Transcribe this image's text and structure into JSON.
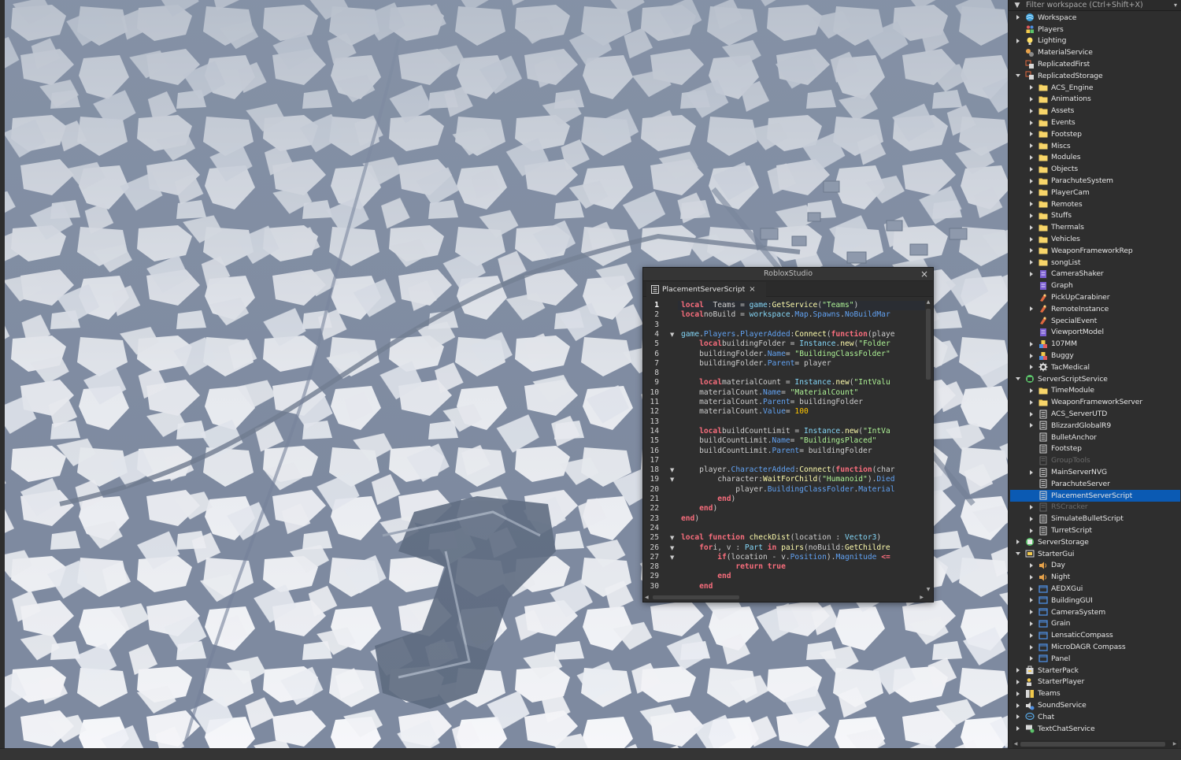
{
  "explorer": {
    "filter_placeholder": "Filter workspace (Ctrl+Shift+X)",
    "items": [
      {
        "label": "Workspace",
        "depth": 0,
        "arrow": "right",
        "icon": "workspace"
      },
      {
        "label": "Players",
        "depth": 0,
        "arrow": "none",
        "icon": "players"
      },
      {
        "label": "Lighting",
        "depth": 0,
        "arrow": "right",
        "icon": "lighting"
      },
      {
        "label": "MaterialService",
        "depth": 0,
        "arrow": "none",
        "icon": "material"
      },
      {
        "label": "ReplicatedFirst",
        "depth": 0,
        "arrow": "none",
        "icon": "replicated"
      },
      {
        "label": "ReplicatedStorage",
        "depth": 0,
        "arrow": "down",
        "icon": "replicated"
      },
      {
        "label": "ACS_Engine",
        "depth": 1,
        "arrow": "right",
        "icon": "folder"
      },
      {
        "label": "Animations",
        "depth": 1,
        "arrow": "right",
        "icon": "folder"
      },
      {
        "label": "Assets",
        "depth": 1,
        "arrow": "right",
        "icon": "folder"
      },
      {
        "label": "Events",
        "depth": 1,
        "arrow": "right",
        "icon": "folder"
      },
      {
        "label": "Footstep",
        "depth": 1,
        "arrow": "right",
        "icon": "folder"
      },
      {
        "label": "Miscs",
        "depth": 1,
        "arrow": "right",
        "icon": "folder"
      },
      {
        "label": "Modules",
        "depth": 1,
        "arrow": "right",
        "icon": "folder"
      },
      {
        "label": "Objects",
        "depth": 1,
        "arrow": "right",
        "icon": "folder"
      },
      {
        "label": "ParachuteSystem",
        "depth": 1,
        "arrow": "right",
        "icon": "folder"
      },
      {
        "label": "PlayerCam",
        "depth": 1,
        "arrow": "right",
        "icon": "folder"
      },
      {
        "label": "Remotes",
        "depth": 1,
        "arrow": "right",
        "icon": "folder"
      },
      {
        "label": "Stuffs",
        "depth": 1,
        "arrow": "right",
        "icon": "folder"
      },
      {
        "label": "Thermals",
        "depth": 1,
        "arrow": "right",
        "icon": "folder"
      },
      {
        "label": "Vehicles",
        "depth": 1,
        "arrow": "right",
        "icon": "folder"
      },
      {
        "label": "WeaponFrameworkRep",
        "depth": 1,
        "arrow": "right",
        "icon": "folder"
      },
      {
        "label": "songList",
        "depth": 1,
        "arrow": "right",
        "icon": "folder"
      },
      {
        "label": "CameraShaker",
        "depth": 1,
        "arrow": "right",
        "icon": "module"
      },
      {
        "label": "Graph",
        "depth": 1,
        "arrow": "none",
        "icon": "module"
      },
      {
        "label": "PickUpCarabiner",
        "depth": 1,
        "arrow": "none",
        "icon": "remote"
      },
      {
        "label": "RemoteInstance",
        "depth": 1,
        "arrow": "right",
        "icon": "remote"
      },
      {
        "label": "SpecialEvent",
        "depth": 1,
        "arrow": "none",
        "icon": "remote"
      },
      {
        "label": "ViewportModel",
        "depth": 1,
        "arrow": "none",
        "icon": "module"
      },
      {
        "label": "107MM",
        "depth": 1,
        "arrow": "right",
        "icon": "model"
      },
      {
        "label": "Buggy",
        "depth": 1,
        "arrow": "right",
        "icon": "model"
      },
      {
        "label": "TacMedical",
        "depth": 1,
        "arrow": "right",
        "icon": "gear"
      },
      {
        "label": "ServerScriptService",
        "depth": 0,
        "arrow": "down",
        "icon": "serverscript"
      },
      {
        "label": "TimeModule",
        "depth": 1,
        "arrow": "right",
        "icon": "folder"
      },
      {
        "label": "WeaponFrameworkServer",
        "depth": 1,
        "arrow": "right",
        "icon": "folder"
      },
      {
        "label": "ACS_ServerUTD",
        "depth": 1,
        "arrow": "right",
        "icon": "script"
      },
      {
        "label": "BlizzardGlobalR9",
        "depth": 1,
        "arrow": "right",
        "icon": "script"
      },
      {
        "label": "BulletAnchor",
        "depth": 1,
        "arrow": "none",
        "icon": "script"
      },
      {
        "label": "Footstep",
        "depth": 1,
        "arrow": "none",
        "icon": "script"
      },
      {
        "label": "GroupTools",
        "depth": 1,
        "arrow": "none",
        "icon": "script-dim",
        "dim": true
      },
      {
        "label": "MainServerNVG",
        "depth": 1,
        "arrow": "right",
        "icon": "script"
      },
      {
        "label": "ParachuteServer",
        "depth": 1,
        "arrow": "none",
        "icon": "script"
      },
      {
        "label": "PlacementServerScript",
        "depth": 1,
        "arrow": "none",
        "icon": "script",
        "selected": true
      },
      {
        "label": "RSCracker",
        "depth": 1,
        "arrow": "right",
        "icon": "script-dim",
        "dim": true
      },
      {
        "label": "SimulateBulletScript",
        "depth": 1,
        "arrow": "right",
        "icon": "script"
      },
      {
        "label": "TurretScript",
        "depth": 1,
        "arrow": "right",
        "icon": "script"
      },
      {
        "label": "ServerStorage",
        "depth": 0,
        "arrow": "right",
        "icon": "serverstorage"
      },
      {
        "label": "StarterGui",
        "depth": 0,
        "arrow": "down",
        "icon": "startergui"
      },
      {
        "label": "Day",
        "depth": 1,
        "arrow": "right",
        "icon": "sound"
      },
      {
        "label": "Night",
        "depth": 1,
        "arrow": "right",
        "icon": "sound"
      },
      {
        "label": "AEDXGui",
        "depth": 1,
        "arrow": "right",
        "icon": "screengui"
      },
      {
        "label": "BuildingGUI",
        "depth": 1,
        "arrow": "right",
        "icon": "screengui"
      },
      {
        "label": "CameraSystem",
        "depth": 1,
        "arrow": "right",
        "icon": "screengui"
      },
      {
        "label": "Grain",
        "depth": 1,
        "arrow": "right",
        "icon": "screengui"
      },
      {
        "label": "LensaticCompass",
        "depth": 1,
        "arrow": "right",
        "icon": "screengui"
      },
      {
        "label": "MicroDAGR Compass",
        "depth": 1,
        "arrow": "right",
        "icon": "screengui"
      },
      {
        "label": "Panel",
        "depth": 1,
        "arrow": "right",
        "icon": "screengui"
      },
      {
        "label": "StarterPack",
        "depth": 0,
        "arrow": "right",
        "icon": "starterpack"
      },
      {
        "label": "StarterPlayer",
        "depth": 0,
        "arrow": "right",
        "icon": "starterplayer"
      },
      {
        "label": "Teams",
        "depth": 0,
        "arrow": "right",
        "icon": "teams"
      },
      {
        "label": "SoundService",
        "depth": 0,
        "arrow": "right",
        "icon": "soundservice"
      },
      {
        "label": "Chat",
        "depth": 0,
        "arrow": "right",
        "icon": "chat"
      },
      {
        "label": "TextChatService",
        "depth": 0,
        "arrow": "right",
        "icon": "textchat"
      }
    ]
  },
  "script_window": {
    "title": "RobloxStudio",
    "tab_label": "PlacementServerScript",
    "current_line": 1,
    "lines": [
      {
        "n": "1",
        "fold": "",
        "tokens": [
          [
            "k",
            "local"
          ],
          [
            "",
            "  Teams = "
          ],
          [
            "t",
            "game"
          ],
          [
            "",
            ":"
          ],
          [
            "f",
            "GetService"
          ],
          [
            "",
            "("
          ],
          [
            "s",
            "\"Teams\""
          ],
          [
            "",
            ")"
          ]
        ]
      },
      {
        "n": "2",
        "fold": "",
        "tokens": [
          [
            "k",
            "local"
          ],
          [
            "",
            ""
          ],
          [
            "",
            "noBuild = "
          ],
          [
            "t",
            "workspace"
          ],
          [
            "",
            "."
          ],
          [
            "p",
            "Map"
          ],
          [
            "",
            "."
          ],
          [
            "p",
            "Spawns"
          ],
          [
            "",
            "."
          ],
          [
            "p",
            "NoBuildMar"
          ]
        ]
      },
      {
        "n": "3",
        "fold": "",
        "tokens": []
      },
      {
        "n": "4",
        "fold": "▼",
        "tokens": [
          [
            "t",
            "game"
          ],
          [
            "",
            "."
          ],
          [
            "p",
            "Players"
          ],
          [
            "",
            "."
          ],
          [
            "p",
            "PlayerAdded"
          ],
          [
            "",
            ":"
          ],
          [
            "f",
            "Connect"
          ],
          [
            "",
            "("
          ],
          [
            "k",
            "function"
          ],
          [
            "",
            "(playe"
          ]
        ]
      },
      {
        "n": "5",
        "fold": "",
        "tokens": [
          [
            "",
            "    "
          ],
          [
            "k",
            "local"
          ],
          [
            "",
            ""
          ],
          [
            "",
            "buildingFolder = "
          ],
          [
            "t",
            "Instance"
          ],
          [
            "",
            "."
          ],
          [
            "f",
            "new"
          ],
          [
            "",
            "("
          ],
          [
            "s",
            "\"Folder"
          ]
        ]
      },
      {
        "n": "6",
        "fold": "",
        "tokens": [
          [
            "",
            "    buildingFolder."
          ],
          [
            "p",
            "Name"
          ],
          [
            "",
            ""
          ],
          [
            "",
            "= "
          ],
          [
            "s",
            "\"BuildingClassFolder\""
          ]
        ]
      },
      {
        "n": "7",
        "fold": "",
        "tokens": [
          [
            "",
            "    buildingFolder."
          ],
          [
            "p",
            "Parent"
          ],
          [
            "",
            ""
          ],
          [
            "",
            "= player"
          ]
        ]
      },
      {
        "n": "8",
        "fold": "",
        "tokens": []
      },
      {
        "n": "9",
        "fold": "",
        "tokens": [
          [
            "",
            "    "
          ],
          [
            "k",
            "local"
          ],
          [
            "",
            ""
          ],
          [
            "",
            "materialCount = "
          ],
          [
            "t",
            "Instance"
          ],
          [
            "",
            "."
          ],
          [
            "f",
            "new"
          ],
          [
            "",
            "("
          ],
          [
            "s",
            "\"IntValu"
          ]
        ]
      },
      {
        "n": "10",
        "fold": "",
        "tokens": [
          [
            "",
            "    materialCount."
          ],
          [
            "p",
            "Name"
          ],
          [
            "",
            ""
          ],
          [
            "",
            "= "
          ],
          [
            "s",
            "\"MaterialCount\""
          ]
        ]
      },
      {
        "n": "11",
        "fold": "",
        "tokens": [
          [
            "",
            "    materialCount."
          ],
          [
            "p",
            "Parent"
          ],
          [
            "",
            ""
          ],
          [
            "",
            "= buildingFolder"
          ]
        ]
      },
      {
        "n": "12",
        "fold": "",
        "tokens": [
          [
            "",
            "    materialCount."
          ],
          [
            "p",
            "Value"
          ],
          [
            "",
            ""
          ],
          [
            "",
            "= "
          ],
          [
            "n",
            "100"
          ]
        ]
      },
      {
        "n": "13",
        "fold": "",
        "tokens": []
      },
      {
        "n": "14",
        "fold": "",
        "tokens": [
          [
            "",
            "    "
          ],
          [
            "k",
            "local"
          ],
          [
            "",
            ""
          ],
          [
            "",
            "buildCountLimit = "
          ],
          [
            "t",
            "Instance"
          ],
          [
            "",
            "."
          ],
          [
            "f",
            "new"
          ],
          [
            "",
            "("
          ],
          [
            "s",
            "\"IntVa"
          ]
        ]
      },
      {
        "n": "15",
        "fold": "",
        "tokens": [
          [
            "",
            "    buildCountLimit."
          ],
          [
            "p",
            "Name"
          ],
          [
            "",
            ""
          ],
          [
            "",
            "= "
          ],
          [
            "s",
            "\"BuildingsPlaced\""
          ]
        ]
      },
      {
        "n": "16",
        "fold": "",
        "tokens": [
          [
            "",
            "    buildCountLimit."
          ],
          [
            "p",
            "Parent"
          ],
          [
            "",
            ""
          ],
          [
            "",
            "= buildingFolder"
          ]
        ]
      },
      {
        "n": "17",
        "fold": "",
        "tokens": []
      },
      {
        "n": "18",
        "fold": "▼",
        "tokens": [
          [
            "",
            "    player."
          ],
          [
            "p",
            "CharacterAdded"
          ],
          [
            "",
            ":"
          ],
          [
            "f",
            "Connect"
          ],
          [
            "",
            "("
          ],
          [
            "k",
            "function"
          ],
          [
            "",
            "(char"
          ]
        ]
      },
      {
        "n": "19",
        "fold": "▼",
        "tokens": [
          [
            "",
            "        character:"
          ],
          [
            "f",
            "WaitForChild"
          ],
          [
            "",
            "("
          ],
          [
            "s",
            "\"Humanoid\""
          ],
          [
            "",
            ")."
          ],
          [
            "p",
            "Died"
          ]
        ]
      },
      {
        "n": "20",
        "fold": "",
        "tokens": [
          [
            "",
            "            player."
          ],
          [
            "p",
            "BuildingClassFolder"
          ],
          [
            "",
            "."
          ],
          [
            "p",
            "Material"
          ]
        ]
      },
      {
        "n": "21",
        "fold": "",
        "tokens": [
          [
            "",
            "        "
          ],
          [
            "k",
            "end"
          ],
          [
            "",
            ")"
          ]
        ]
      },
      {
        "n": "22",
        "fold": "",
        "tokens": [
          [
            "",
            "    "
          ],
          [
            "k",
            "end"
          ],
          [
            "",
            ")"
          ]
        ]
      },
      {
        "n": "23",
        "fold": "",
        "tokens": [
          [
            "k",
            "end"
          ],
          [
            "",
            ")"
          ]
        ]
      },
      {
        "n": "24",
        "fold": "",
        "tokens": []
      },
      {
        "n": "25",
        "fold": "▼",
        "tokens": [
          [
            "k",
            "local function"
          ],
          [
            "",
            ""
          ],
          [
            "f",
            " checkDist"
          ],
          [
            "",
            "(location : "
          ],
          [
            "t",
            "Vector3"
          ],
          [
            "",
            ")"
          ]
        ]
      },
      {
        "n": "26",
        "fold": "▼",
        "tokens": [
          [
            "",
            "    "
          ],
          [
            "k",
            "for"
          ],
          [
            "",
            ""
          ],
          [
            "",
            ""
          ],
          [
            "",
            "i, v : "
          ],
          [
            "t",
            "Part"
          ],
          [
            "",
            ""
          ],
          [
            "k",
            " in"
          ],
          [
            "",
            ""
          ],
          [
            "f",
            " pairs"
          ],
          [
            "",
            "(noBuild:"
          ],
          [
            "f",
            "GetChildre"
          ]
        ]
      },
      {
        "n": "27",
        "fold": "▼",
        "tokens": [
          [
            "",
            "        "
          ],
          [
            "k",
            "if"
          ],
          [
            "",
            ""
          ],
          [
            "",
            "(location - v."
          ],
          [
            "p",
            "Position"
          ],
          [
            "",
            ")."
          ],
          [
            "p",
            "Magnitude"
          ],
          [
            "",
            ""
          ],
          [
            "",
            ""
          ],
          [
            "k",
            " <="
          ]
        ]
      },
      {
        "n": "28",
        "fold": "",
        "tokens": [
          [
            "",
            "            "
          ],
          [
            "k",
            "return true"
          ]
        ]
      },
      {
        "n": "29",
        "fold": "",
        "tokens": [
          [
            "",
            "        "
          ],
          [
            "k",
            "end"
          ]
        ]
      },
      {
        "n": "30",
        "fold": "",
        "tokens": [
          [
            "",
            "    "
          ],
          [
            "k",
            "end"
          ]
        ]
      }
    ]
  },
  "colors": {
    "selection": "#0b5ab3",
    "folder": "#f2c94c",
    "keyword": "#f86d7c",
    "string": "#adf195",
    "number": "#ffc600",
    "property": "#61a1f1",
    "builtin": "#84d6f7",
    "method": "#fdfbac"
  }
}
